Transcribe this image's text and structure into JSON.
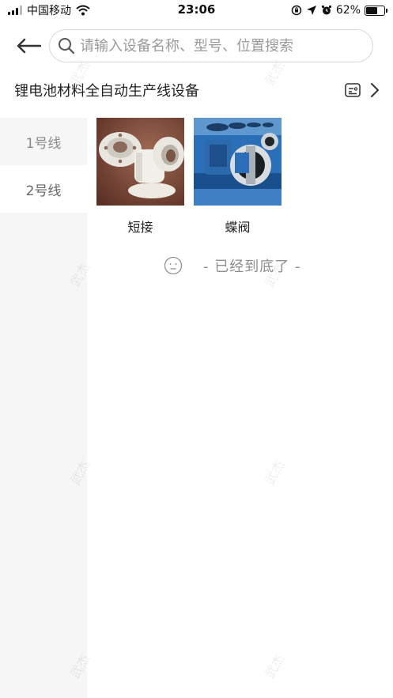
{
  "status_bar": {
    "carrier": "中国移动",
    "time": "23:06",
    "battery_percent": "62%",
    "battery_level": 0.62
  },
  "search": {
    "placeholder": "请输入设备名称、型号、位置搜索",
    "value": ""
  },
  "line_title": "锂电池材料全自动生产线设备",
  "sidebar": {
    "items": [
      {
        "label": "1号线",
        "active": false
      },
      {
        "label": "2号线",
        "active": true
      }
    ]
  },
  "products": [
    {
      "name": "短接"
    },
    {
      "name": "蝶阀"
    }
  ],
  "end_text": "- 已经到底了 -",
  "watermark": "武杰",
  "colors": {
    "sidebar_bg": "#f6f6f6",
    "muted_text": "#8f8f8f",
    "border": "#d8d8d8"
  }
}
